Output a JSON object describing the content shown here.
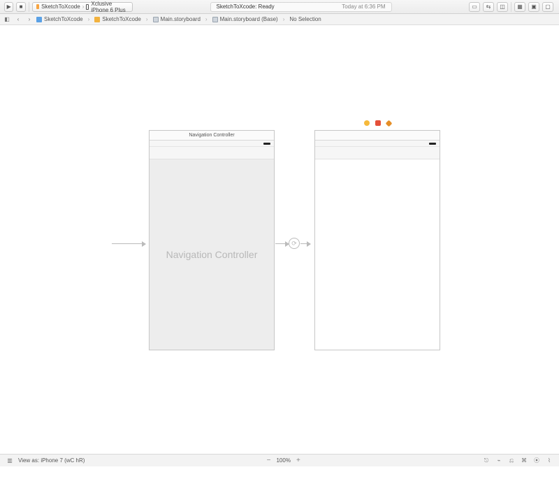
{
  "toolbar": {
    "run_glyph": "▶",
    "stop_glyph": "■",
    "scheme_name": "SketchToXcode",
    "scheme_device": "Xclusive iPhone 6 Plus",
    "status_product": "SketchToXcode:",
    "status_state": "Ready",
    "status_time": "Today at 6:36 PM",
    "right_glyphs": [
      "▭",
      "⇆",
      "◫",
      "▦",
      "▣",
      "▢"
    ]
  },
  "jumpbar": {
    "related_glyph": "◧",
    "back_glyph": "‹",
    "fwd_glyph": "›",
    "crumbs": [
      {
        "icon": "proj",
        "label": "SketchToXcode"
      },
      {
        "icon": "folder",
        "label": "SketchToXcode"
      },
      {
        "icon": "file",
        "label": "Main.storyboard"
      },
      {
        "icon": "file",
        "label": "Main.storyboard (Base)"
      },
      {
        "icon": "none",
        "label": "No Selection"
      }
    ]
  },
  "canvas": {
    "nav_scene_title": "Navigation Controller",
    "nav_scene_body": "Navigation Controller",
    "vc_scene_title": ""
  },
  "bottombar": {
    "outline_glyph": "▥",
    "view_as_label": "View as: iPhone 7 (wC hR)",
    "zoom_out": "−",
    "zoom_pct": "100%",
    "zoom_in": "+",
    "right_glyphs": [
      "⎋",
      "⌁",
      "⎌",
      "⌘",
      "⦿",
      "⌇"
    ]
  }
}
